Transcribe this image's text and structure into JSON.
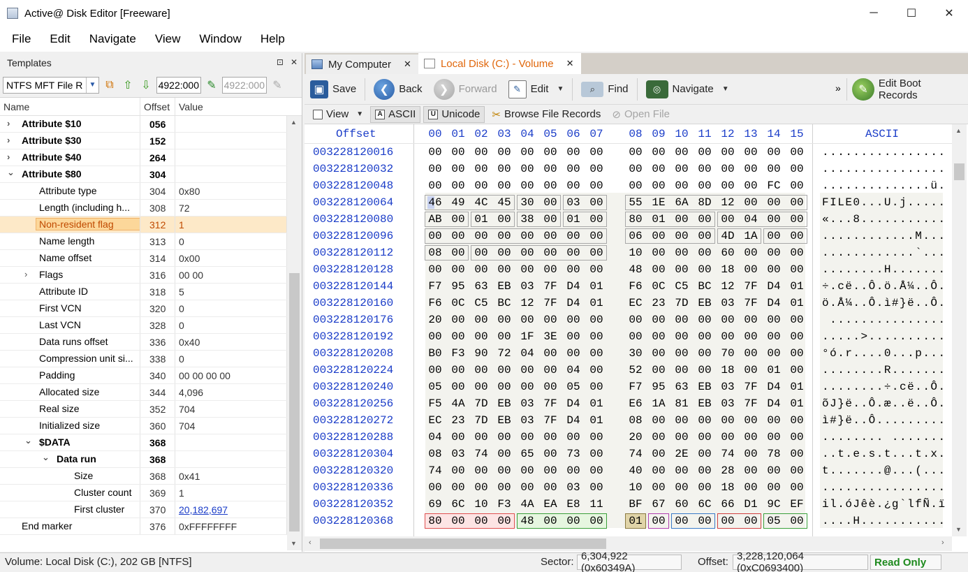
{
  "window": {
    "title": "Active@ Disk Editor [Freeware]",
    "minimize": "─",
    "maximize": "☐",
    "close": "✕"
  },
  "menu": [
    "File",
    "Edit",
    "Navigate",
    "View",
    "Window",
    "Help"
  ],
  "templates": {
    "title": "Templates",
    "pin": "⊡",
    "close": "✕",
    "combo_value": "NTFS MFT File R",
    "offset_from": "4922:000",
    "offset_to": "4922:000",
    "columns": [
      "Name",
      "Offset",
      "Value"
    ],
    "rows": [
      {
        "name": "Attribute $10",
        "offset": "056",
        "value": "",
        "level": 0,
        "exp": "›",
        "bold": true
      },
      {
        "name": "Attribute $30",
        "offset": "152",
        "value": "",
        "level": 0,
        "exp": "›",
        "bold": true
      },
      {
        "name": "Attribute $40",
        "offset": "264",
        "value": "",
        "level": 0,
        "exp": "›",
        "bold": true
      },
      {
        "name": "Attribute $80",
        "offset": "304",
        "value": "",
        "level": 0,
        "exp": "⌄",
        "bold": true
      },
      {
        "name": "Attribute type",
        "offset": "304",
        "value": "0x80",
        "level": 1
      },
      {
        "name": "Length (including h...",
        "offset": "308",
        "value": "72",
        "level": 1
      },
      {
        "name": "Non-resident flag",
        "offset": "312",
        "value": "1",
        "level": 1,
        "selected": true
      },
      {
        "name": "Name length",
        "offset": "313",
        "value": "0",
        "level": 1
      },
      {
        "name": "Name offset",
        "offset": "314",
        "value": "0x00",
        "level": 1
      },
      {
        "name": "Flags",
        "offset": "316",
        "value": "00 00",
        "level": 1,
        "exp": "›"
      },
      {
        "name": "Attribute ID",
        "offset": "318",
        "value": "5",
        "level": 1
      },
      {
        "name": "First VCN",
        "offset": "320",
        "value": "0",
        "level": 1
      },
      {
        "name": "Last VCN",
        "offset": "328",
        "value": "0",
        "level": 1
      },
      {
        "name": "Data runs offset",
        "offset": "336",
        "value": "0x40",
        "level": 1
      },
      {
        "name": "Compression unit si...",
        "offset": "338",
        "value": "0",
        "level": 1
      },
      {
        "name": "Padding",
        "offset": "340",
        "value": "00 00 00 00",
        "level": 1
      },
      {
        "name": "Allocated size",
        "offset": "344",
        "value": "4,096",
        "level": 1
      },
      {
        "name": "Real size",
        "offset": "352",
        "value": "704",
        "level": 1
      },
      {
        "name": "Initialized size",
        "offset": "360",
        "value": "704",
        "level": 1
      },
      {
        "name": "$DATA",
        "offset": "368",
        "value": "",
        "level": 1,
        "exp": "⌄",
        "bold": true
      },
      {
        "name": "Data run",
        "offset": "368",
        "value": "",
        "level": 2,
        "exp": "⌄",
        "bold": true
      },
      {
        "name": "Size",
        "offset": "368",
        "value": "0x41",
        "level": 3
      },
      {
        "name": "Cluster count",
        "offset": "369",
        "value": "1",
        "level": 3
      },
      {
        "name": "First cluster",
        "offset": "370",
        "value": "20,182,697",
        "level": 3,
        "link": true
      },
      {
        "name": "End marker",
        "offset": "376",
        "value": "0xFFFFFFFF",
        "level": 0
      }
    ]
  },
  "tabs": [
    {
      "label": "My Computer",
      "active": false
    },
    {
      "label": "Local Disk (C:) - Volume",
      "active": true
    }
  ],
  "toolbar": {
    "save": "Save",
    "back": "Back",
    "forward": "Forward",
    "edit": "Edit",
    "find": "Find",
    "navigate": "Navigate",
    "more": "»",
    "edit_boot": "Edit Boot Records"
  },
  "subtoolbar": {
    "view": "View",
    "ascii": "ASCII",
    "unicode": "Unicode",
    "browse": "Browse File Records",
    "open_file": "Open File"
  },
  "hex": {
    "offset_header": "Offset",
    "col_headers": [
      "00",
      "01",
      "02",
      "03",
      "04",
      "05",
      "06",
      "07",
      "08",
      "09",
      "10",
      "11",
      "12",
      "13",
      "14",
      "15"
    ],
    "ascii_header": "ASCII",
    "rows": [
      {
        "offset": "003228120016",
        "bytes": "00 00 00 00 00 00 00 00 00 00 00 00 00 00 00 00",
        "ascii": "................"
      },
      {
        "offset": "003228120032",
        "bytes": "00 00 00 00 00 00 00 00 00 00 00 00 00 00 00 00",
        "ascii": "................"
      },
      {
        "offset": "003228120048",
        "bytes": "00 00 00 00 00 00 00 00 00 00 00 00 00 00 FC 00",
        "ascii": "..............ü."
      },
      {
        "offset": "003228120064",
        "bytes": "46 49 4C 45 30 00 03 00 55 1E 6A 8D 12 00 00 00",
        "ascii": "FILE0...U.j....."
      },
      {
        "offset": "003228120080",
        "bytes": "AB 00 01 00 38 00 01 00 80 01 00 00 00 04 00 00",
        "ascii": "«...8..........."
      },
      {
        "offset": "003228120096",
        "bytes": "00 00 00 00 00 00 00 00 06 00 00 00 4D 1A 00 00",
        "ascii": "............M..."
      },
      {
        "offset": "003228120112",
        "bytes": "08 00 00 00 00 00 00 00 10 00 00 00 60 00 00 00",
        "ascii": "............`..."
      },
      {
        "offset": "003228120128",
        "bytes": "00 00 00 00 00 00 00 00 48 00 00 00 18 00 00 00",
        "ascii": "........H......."
      },
      {
        "offset": "003228120144",
        "bytes": "F7 95 63 EB 03 7F D4 01 F6 0C C5 BC 12 7F D4 01",
        "ascii": "÷.cë..Ô.ö.Å¼..Ô."
      },
      {
        "offset": "003228120160",
        "bytes": "F6 0C C5 BC 12 7F D4 01 EC 23 7D EB 03 7F D4 01",
        "ascii": "ö.Å¼..Ô.ì#}ë..Ô."
      },
      {
        "offset": "003228120176",
        "bytes": "20 00 00 00 00 00 00 00 00 00 00 00 00 00 00 00",
        "ascii": " ..............."
      },
      {
        "offset": "003228120192",
        "bytes": "00 00 00 00 1F 3E 00 00 00 00 00 00 00 00 00 00",
        "ascii": ".....>.........."
      },
      {
        "offset": "003228120208",
        "bytes": "B0 F3 90 72 04 00 00 00 30 00 00 00 70 00 00 00",
        "ascii": "°ó.r....0...p..."
      },
      {
        "offset": "003228120224",
        "bytes": "00 00 00 00 00 00 04 00 52 00 00 00 18 00 01 00",
        "ascii": "........R......."
      },
      {
        "offset": "003228120240",
        "bytes": "05 00 00 00 00 00 05 00 F7 95 63 EB 03 7F D4 01",
        "ascii": "........÷.cë..Ô."
      },
      {
        "offset": "003228120256",
        "bytes": "F5 4A 7D EB 03 7F D4 01 E6 1A 81 EB 03 7F D4 01",
        "ascii": "õJ}ë..Ô.æ..ë..Ô."
      },
      {
        "offset": "003228120272",
        "bytes": "EC 23 7D EB 03 7F D4 01 08 00 00 00 00 00 00 00",
        "ascii": "ì#}ë..Ô........."
      },
      {
        "offset": "003228120288",
        "bytes": "04 00 00 00 00 00 00 00 20 00 00 00 00 00 00 00",
        "ascii": "........ ......."
      },
      {
        "offset": "003228120304",
        "bytes": "08 03 74 00 65 00 73 00 74 00 2E 00 74 00 78 00",
        "ascii": "..t.e.s.t...t.x."
      },
      {
        "offset": "003228120320",
        "bytes": "74 00 00 00 00 00 00 00 40 00 00 00 28 00 00 00",
        "ascii": "t.......@...(..."
      },
      {
        "offset": "003228120336",
        "bytes": "00 00 00 00 00 00 03 00 10 00 00 00 18 00 00 00",
        "ascii": "................"
      },
      {
        "offset": "003228120352",
        "bytes": "69 6C 10 F3 4A EA E8 11 BF 67 60 6C 66 D1 9C EF",
        "ascii": "il.óJêè.¿g`lfÑ.ï"
      },
      {
        "offset": "003228120368",
        "bytes": "80 00 00 00 48 00 00 00 01 00 00 00 00 00 05 00",
        "ascii": "....H..........."
      }
    ]
  },
  "status": {
    "volume": "Volume: Local Disk (C:), 202 GB [NTFS]",
    "sector_label": "Sector:",
    "sector_value": "6,304,922 (0x60349A)",
    "offset_label": "Offset:",
    "offset_value": "3,228,120,064 (0xC0693400)",
    "mode": "Read Only"
  },
  "colors": {
    "accent": "#e0660a",
    "hex_offset": "#1a3cc8",
    "readonly": "#1e8a1e"
  }
}
